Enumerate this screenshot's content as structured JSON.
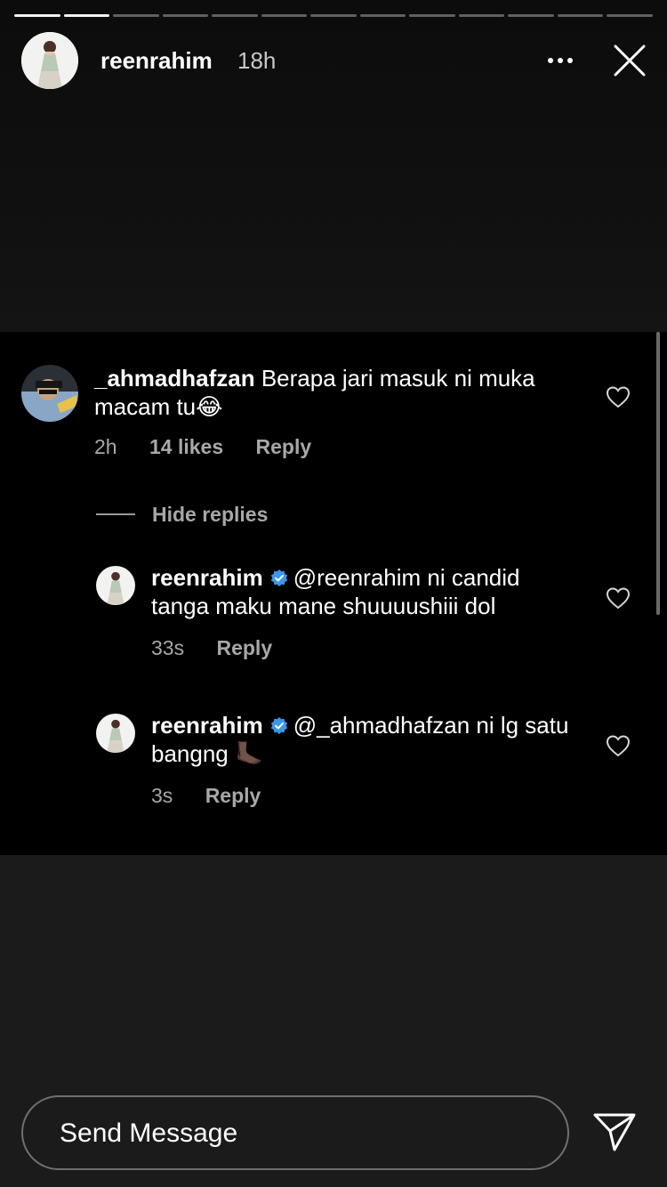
{
  "story": {
    "progress": {
      "total": 13,
      "current_index": 1
    },
    "username": "reenrahim",
    "time": "18h",
    "more_icon": "more-horizontal-icon",
    "close_icon": "close-icon"
  },
  "comments": {
    "main": {
      "username": "_ahmadhafzan",
      "text": "Berapa jari masuk ni muka macam tu😂",
      "time": "2h",
      "likes": "14 likes",
      "reply_label": "Reply"
    },
    "hide_replies_label": "Hide replies",
    "replies": [
      {
        "username": "reenrahim",
        "text": "@reenrahim ni candid tanga maku mane shuuuushiii dol",
        "time": "33s",
        "reply_label": "Reply"
      },
      {
        "username": "reenrahim",
        "text": "@_ahmadhafzan ni lg satu bangng 🦶🏿",
        "time": "3s",
        "reply_label": "Reply"
      }
    ]
  },
  "footer": {
    "send_message_placeholder": "Send Message",
    "send_icon": "direct-send-icon"
  },
  "colors": {
    "verified": "#3897f0",
    "panel_bg": "#000000",
    "page_bg": "#1b1b1b"
  }
}
